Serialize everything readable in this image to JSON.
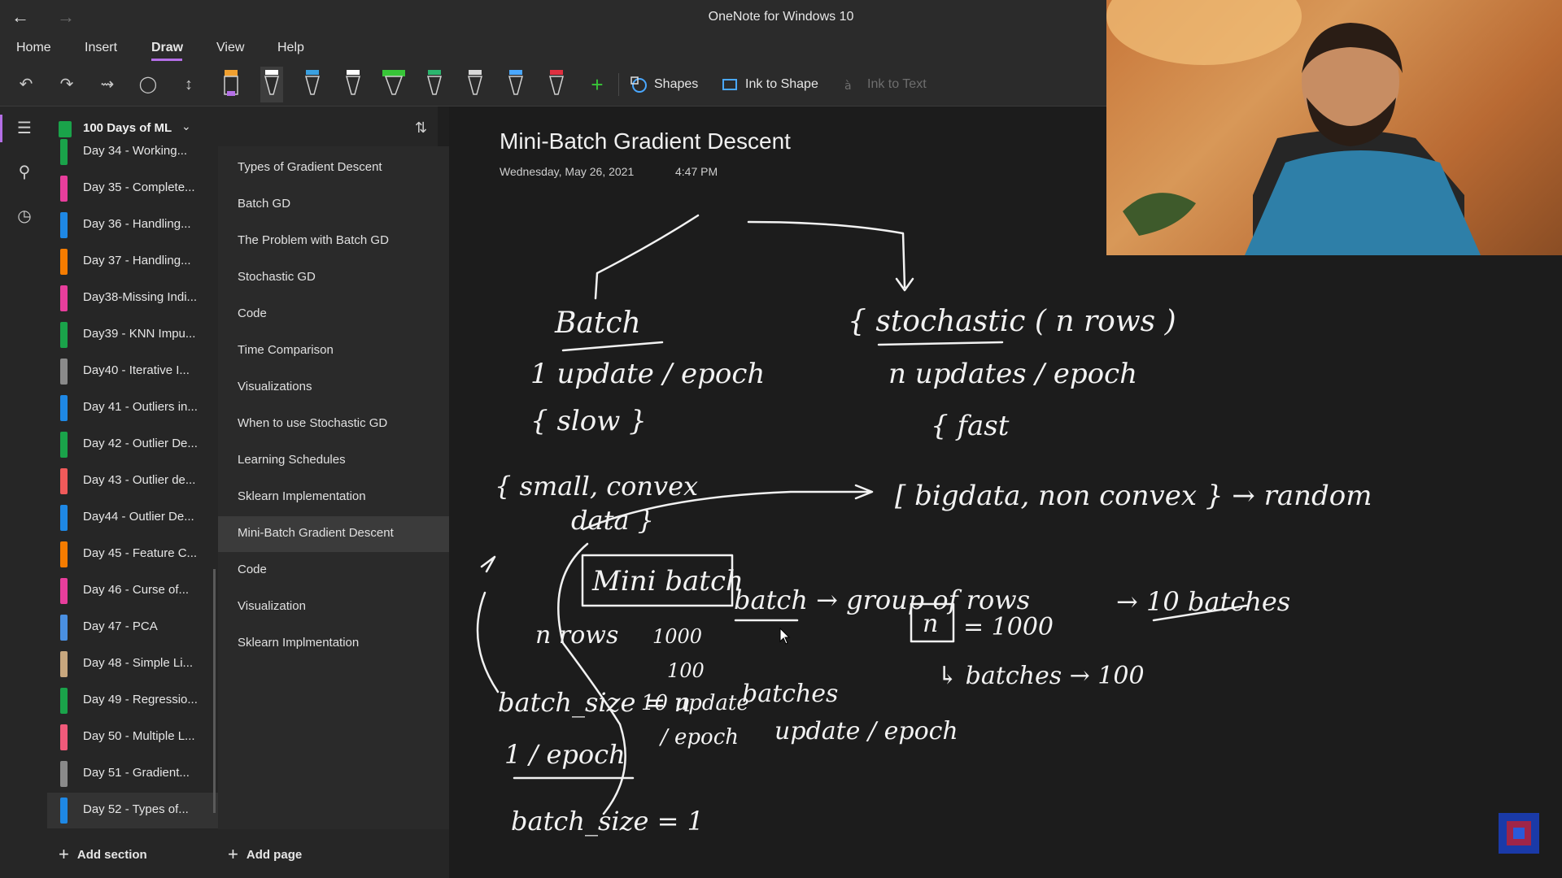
{
  "window": {
    "title": "OneNote for Windows 10"
  },
  "menu": {
    "items": [
      "Home",
      "Insert",
      "Draw",
      "View",
      "Help"
    ],
    "active": "Draw"
  },
  "toolbar": {
    "shapes_label": "Shapes",
    "ink_to_shape_label": "Ink to Shape",
    "ink_to_text_label": "Ink to Text",
    "pen_colors": [
      "#f0a030",
      "#ffffff",
      "#3aa0e0",
      "#ffffff",
      "#38c538",
      "#2bb56e",
      "#d8d8d8",
      "#4aa8ff",
      "#e03040"
    ]
  },
  "notebook": {
    "name": "100 Days of ML"
  },
  "sections": [
    {
      "label": "Day 34 - Working...",
      "color": "#1aa34a"
    },
    {
      "label": "Day 35 - Complete...",
      "color": "#e83e9c"
    },
    {
      "label": "Day 36 - Handling...",
      "color": "#1e88e5"
    },
    {
      "label": "Day 37 - Handling...",
      "color": "#f57c00"
    },
    {
      "label": "Day38-Missing Indi...",
      "color": "#e83e9c"
    },
    {
      "label": "Day39 - KNN Impu...",
      "color": "#1aa34a"
    },
    {
      "label": "Day40 - Iterative I...",
      "color": "#8a8a8a"
    },
    {
      "label": "Day 41 - Outliers in...",
      "color": "#1e88e5"
    },
    {
      "label": "Day 42 - Outlier De...",
      "color": "#1aa34a"
    },
    {
      "label": "Day 43 - Outlier de...",
      "color": "#f05a5a"
    },
    {
      "label": "Day44 - Outlier De...",
      "color": "#1e88e5"
    },
    {
      "label": "Day 45 - Feature C...",
      "color": "#f57c00"
    },
    {
      "label": "Day 46 - Curse of...",
      "color": "#e83e9c"
    },
    {
      "label": "Day 47 - PCA",
      "color": "#4a90e2"
    },
    {
      "label": "Day 48 - Simple Li...",
      "color": "#c8a77e"
    },
    {
      "label": "Day 49 - Regressio...",
      "color": "#1aa34a"
    },
    {
      "label": "Day 50 - Multiple L...",
      "color": "#f05a7a"
    },
    {
      "label": "Day 51 - Gradient...",
      "color": "#8a8a8a"
    },
    {
      "label": "Day 52 - Types of...",
      "color": "#1e88e5"
    }
  ],
  "active_section_index": 18,
  "pages": [
    "Types of Gradient Descent",
    "Batch GD",
    "The Problem with Batch GD",
    "Stochastic GD",
    "Code",
    "Time Comparison",
    "Visualizations",
    "When to use Stochastic GD",
    "Learning Schedules",
    "Sklearn Implementation",
    "Mini-Batch Gradient Descent",
    "Code",
    "Visualization",
    "Sklearn Implmentation"
  ],
  "active_page_index": 10,
  "add_section_label": "Add section",
  "add_page_label": "Add page",
  "page": {
    "title": "Mini-Batch Gradient Descent",
    "date": "Wednesday, May 26, 2021",
    "time": "4:47 PM"
  },
  "ink": {
    "batch": "Batch",
    "batch_update": "1 update / epoch",
    "batch_slow": "{ slow }",
    "batch_small": "{ small, convex",
    "batch_data": "data }",
    "stochastic": "{ stochastic ( n rows )",
    "stoch_updates": "n updates / epoch",
    "stoch_fast": "{ fast",
    "bigdata": "[ bigdata, non convex } → random",
    "mini_batch": "Mini batch",
    "batch_group": "batch → group of rows",
    "n_eq": "= 1000",
    "ten_batches": "→ 10 batches",
    "batches_100": "↳ batches → 100",
    "n_rows": "n rows",
    "batch_size_n": "batch_size = n",
    "one_epoch": "1 / epoch",
    "batch_size_1": "batch_size = 1",
    "n_1000": "1000",
    "n_100": "100",
    "ten_update": "10 update",
    "epoch_small": "/ epoch",
    "batches_update": "batches",
    "update_epoch": "update / epoch",
    "n_box": "n"
  }
}
